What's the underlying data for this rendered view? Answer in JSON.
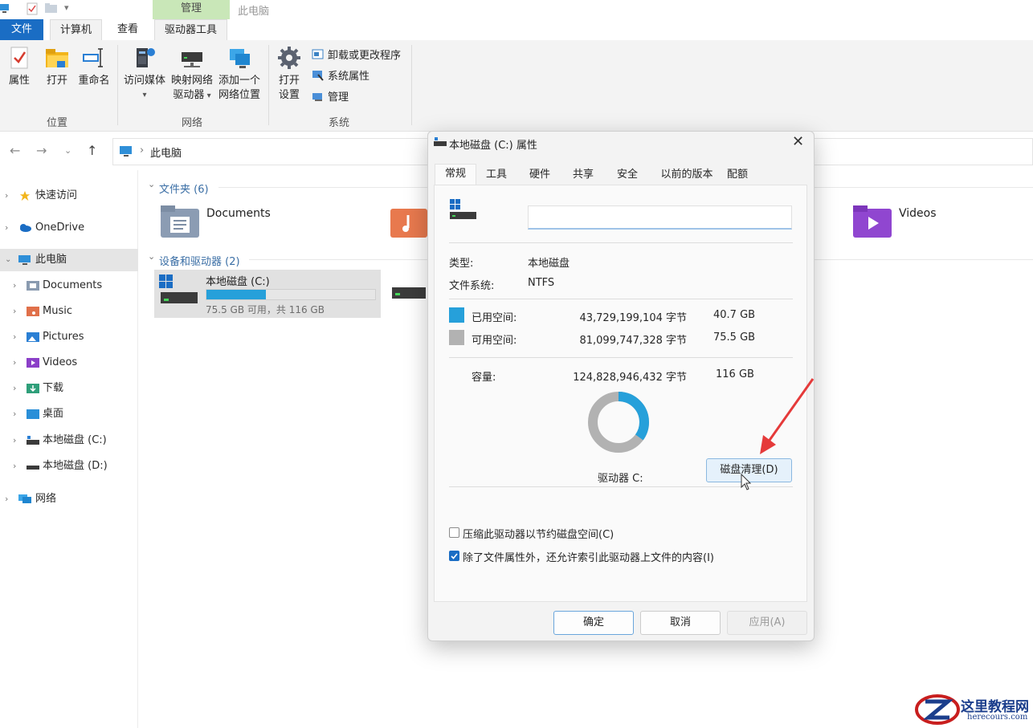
{
  "ribbon": {
    "context_tab": "管理",
    "context_title": "此电脑",
    "tabs": [
      "文件",
      "计算机",
      "查看",
      "驱动器工具"
    ],
    "groups": {
      "location": {
        "label": "位置",
        "buttons": [
          "属性",
          "打开",
          "重命名"
        ]
      },
      "network": {
        "label": "网络",
        "buttons": [
          {
            "line1": "访问媒体",
            "line2": ""
          },
          {
            "line1": "映射网络",
            "line2": "驱动器"
          },
          {
            "line1": "添加一个",
            "line2": "网络位置"
          }
        ]
      },
      "system": {
        "label": "系统",
        "open_settings_line1": "打开",
        "open_settings_line2": "设置",
        "commands": [
          "卸载或更改程序",
          "系统属性",
          "管理"
        ]
      }
    }
  },
  "address": {
    "path": "此电脑",
    "separator": "›"
  },
  "sidebar": {
    "items": [
      {
        "label": "快速访问",
        "icon": "star-icon"
      },
      {
        "label": "OneDrive",
        "icon": "cloud-icon"
      },
      {
        "label": "此电脑",
        "icon": "computer-icon"
      },
      {
        "label": "Documents",
        "icon": "documents-icon"
      },
      {
        "label": "Music",
        "icon": "music-icon"
      },
      {
        "label": "Pictures",
        "icon": "pictures-icon"
      },
      {
        "label": "Videos",
        "icon": "videos-icon"
      },
      {
        "label": "下载",
        "icon": "download-icon"
      },
      {
        "label": "桌面",
        "icon": "desktop-icon"
      },
      {
        "label": "本地磁盘 (C:)",
        "icon": "drive-c-icon"
      },
      {
        "label": "本地磁盘 (D:)",
        "icon": "drive-d-icon"
      },
      {
        "label": "网络",
        "icon": "network-icon"
      }
    ]
  },
  "main": {
    "folders_section": "文件夹 (6)",
    "folders": [
      "Documents",
      "Videos"
    ],
    "devices_section": "设备和驱动器 (2)",
    "drive_c": {
      "name": "本地磁盘 (C:)",
      "space": "75.5 GB 可用，共 116 GB",
      "used_fraction": 0.35
    }
  },
  "dialog": {
    "title": "本地磁盘 (C:) 属性",
    "tabs": [
      "常规",
      "工具",
      "硬件",
      "共享",
      "安全",
      "以前的版本",
      "配额"
    ],
    "name_value": "",
    "type_label": "类型:",
    "type_value": "本地磁盘",
    "fs_label": "文件系统:",
    "fs_value": "NTFS",
    "used_label": "已用空间:",
    "used_bytes": "43,729,199,104 字节",
    "used_gb": "40.7 GB",
    "free_label": "可用空间:",
    "free_bytes": "81,099,747,328 字节",
    "free_gb": "75.5 GB",
    "capacity_label": "容量:",
    "capacity_bytes": "124,828,946,432 字节",
    "capacity_gb": "116 GB",
    "used_fraction": 0.35,
    "drive_label": "驱动器 C:",
    "cleanup_button": "磁盘清理(D)",
    "compress_label": "压缩此驱动器以节约磁盘空间(C)",
    "index_label": "除了文件属性外，还允许索引此驱动器上文件的内容(I)",
    "ok": "确定",
    "cancel": "取消",
    "apply": "应用(A)",
    "colors": {
      "used": "#26a0da",
      "free": "#b2b2b2"
    }
  },
  "watermark": {
    "brand": "这里教程网",
    "domain": "herecours.com"
  }
}
